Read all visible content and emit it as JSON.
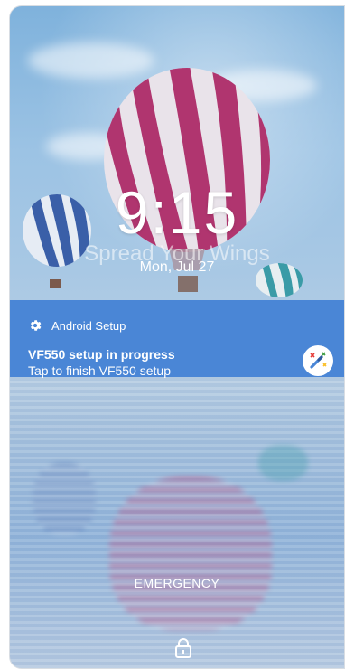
{
  "lockscreen": {
    "time": "9:15",
    "slogan": "Spread Your Wings",
    "date": "Mon, Jul 27",
    "emergency_label": "EMERGENCY"
  },
  "notification": {
    "app_name": "Android Setup",
    "title": "VF550 setup in progress",
    "text": "Tap to finish VF550 setup",
    "app_icon": "gear-icon",
    "large_icon": "magic-wand-icon"
  },
  "icons": {
    "lock": "lock-icon"
  },
  "colors": {
    "notification_bg": "#4a86d6",
    "balloon_pink": "#b0356f",
    "balloon_blue": "#3a5fa8",
    "balloon_teal": "#3a9ba7"
  }
}
